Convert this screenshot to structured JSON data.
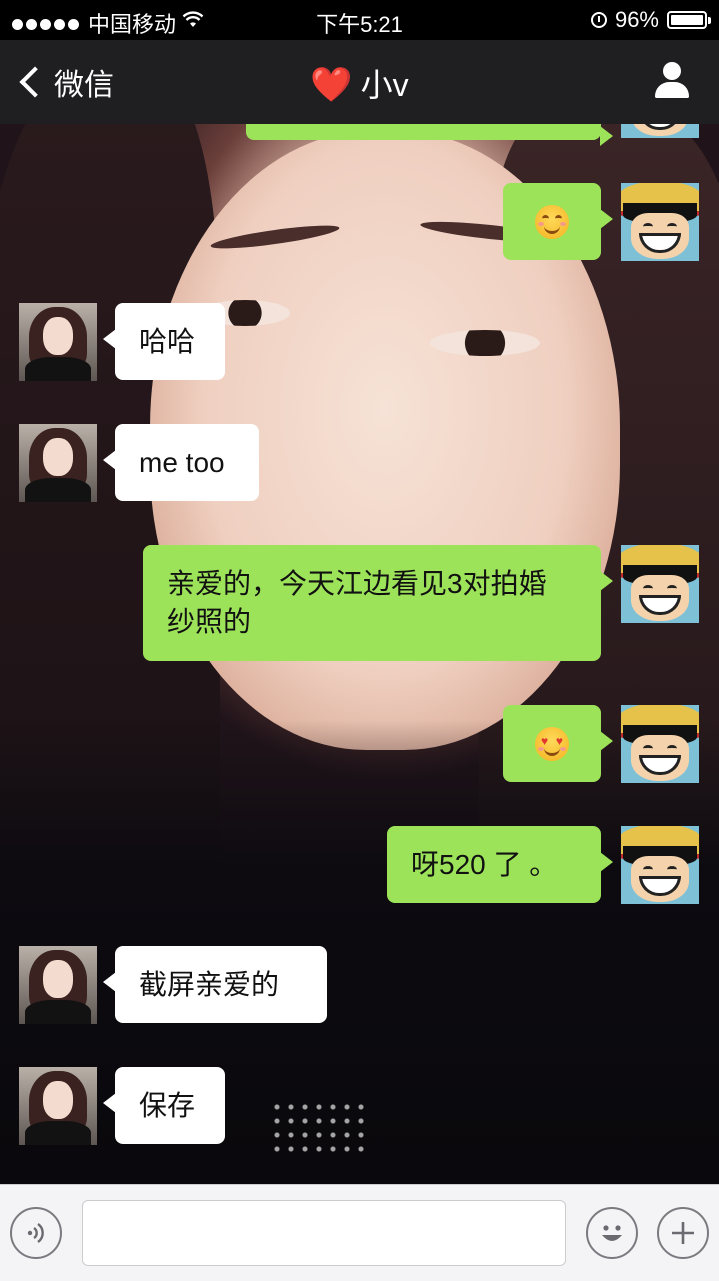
{
  "status_bar": {
    "carrier": "中国移动",
    "time": "下午5:21",
    "battery": "96%",
    "battery_level": 0.96
  },
  "nav": {
    "back_label": "微信",
    "title_emoji": "❤️",
    "title": "小v"
  },
  "messages": [
    {
      "sender": "me",
      "type": "emoji",
      "emoji": "blush-emoji",
      "text": "😊"
    },
    {
      "sender": "them",
      "type": "text",
      "text": "哈哈"
    },
    {
      "sender": "them",
      "type": "text",
      "text": "me too"
    },
    {
      "sender": "me",
      "type": "text",
      "text": "亲爱的，今天江边看见3对拍婚纱照的"
    },
    {
      "sender": "me",
      "type": "emoji",
      "emoji": "heart-eyes-emoji",
      "text": "😍"
    },
    {
      "sender": "me",
      "type": "text",
      "text": "呀520 了 。"
    },
    {
      "sender": "them",
      "type": "text",
      "text": "截屏亲爱的"
    },
    {
      "sender": "them",
      "type": "text",
      "text": "保存"
    }
  ],
  "input_bar": {
    "voice_icon": "voice-icon",
    "emoji_icon": "emoji-icon",
    "plus_icon": "plus-icon",
    "text_value": ""
  },
  "colors": {
    "my_bubble": "#9de35a",
    "their_bubble": "#ffffff",
    "nav_bg": "#1f1f22"
  }
}
